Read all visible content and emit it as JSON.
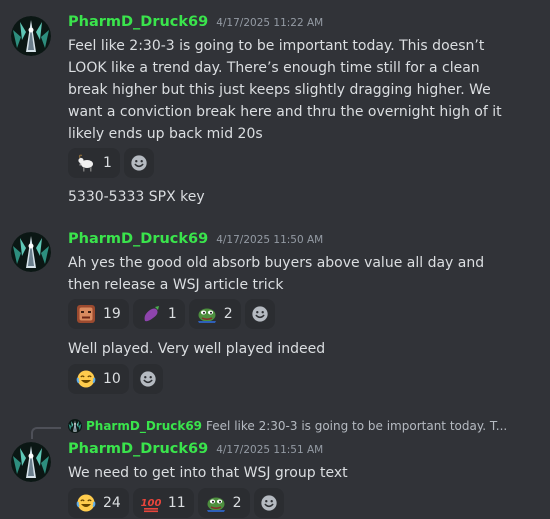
{
  "messages": [
    {
      "author": "PharmD_Druck69",
      "timestamp": "4/17/2025 11:22 AM",
      "lines": [
        "Feel like 2:30-3 is going to be important today. This doesn’t",
        "LOOK like a trend day. There’s enough time still for a clean",
        "break higher but this just keeps slightly dragging higher. We",
        "want a conviction break here and thru the overnight high of it",
        "likely ends up back mid 20s"
      ],
      "reactions": [
        {
          "icon": "goat-emoji",
          "count": "1"
        }
      ],
      "followup": {
        "text": "5330-5333 SPX key"
      }
    },
    {
      "author": "PharmD_Druck69",
      "timestamp": "4/17/2025 11:50 AM",
      "lines": [
        "Ah yes the good old absorb buyers above value all day and",
        "then release a WSJ article trick"
      ],
      "reactions": [
        {
          "icon": "angry-face-emoji",
          "count": "19"
        },
        {
          "icon": "eggplant-emoji",
          "count": "1"
        },
        {
          "icon": "pepe-emoji",
          "count": "2"
        }
      ],
      "followup": {
        "text": "Well played. Very well played indeed",
        "reactions": [
          {
            "icon": "joy-emoji",
            "count": "10"
          }
        ]
      }
    },
    {
      "reply": {
        "author": "PharmD_Druck69",
        "text": "Feel like 2:30-3 is going to be important today. T..."
      },
      "author": "PharmD_Druck69",
      "timestamp": "4/17/2025 11:51 AM",
      "lines": [
        "We need to get into that WSJ group text"
      ],
      "reactions": [
        {
          "icon": "joy-emoji",
          "count": "24"
        },
        {
          "icon": "hundred-emoji",
          "count": "11"
        },
        {
          "icon": "pepe-emoji",
          "count": "2"
        }
      ]
    }
  ]
}
